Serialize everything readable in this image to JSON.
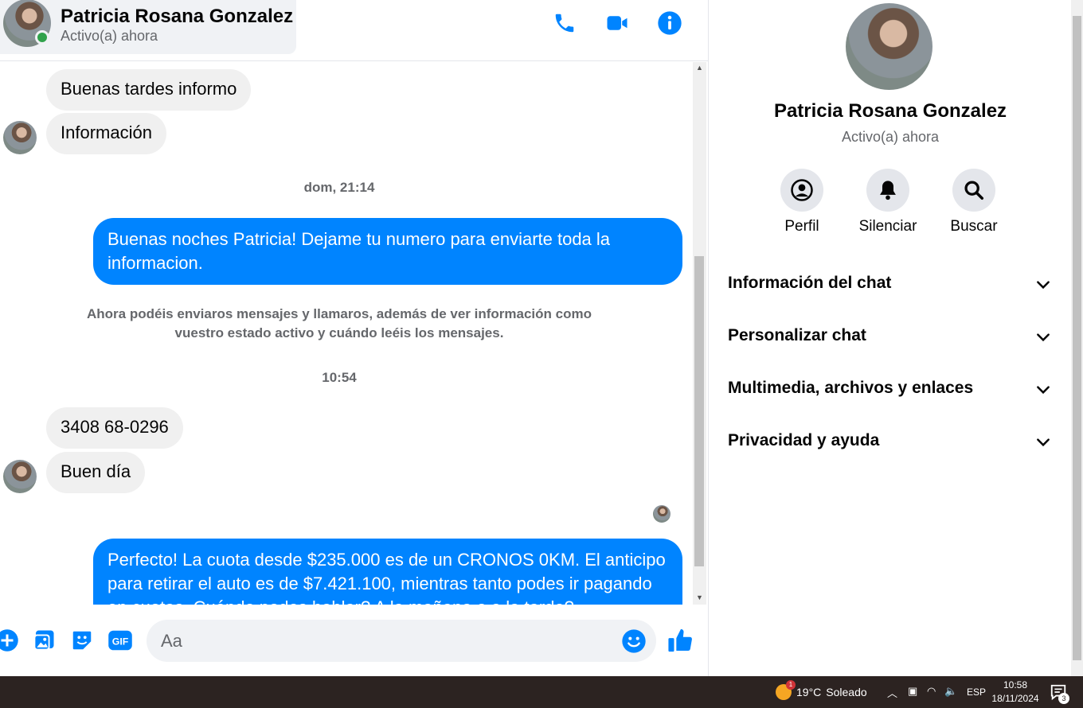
{
  "header": {
    "name": "Patricia Rosana Gonzalez",
    "status": "Activo(a) ahora"
  },
  "messages": {
    "in1": "Buenas tardes informo",
    "in2": "Información",
    "timestamp1": "dom, 21:14",
    "out1": "Buenas noches Patricia! Dejame tu numero para enviarte toda la informacion.",
    "system_note": "Ahora podéis enviaros mensajes y llamaros, además de ver información como vuestro estado activo y cuándo leéis los mensajes.",
    "timestamp2": "10:54",
    "in3": "3408 68-0296",
    "in4": "Buen día",
    "out2": "Perfecto! La cuota desde $235.000 es de un CRONOS 0KM. El anticipo para retirar el auto es de $7.421.100, mientras tanto podes ir pagando en cuotas. Cuándo podes hablar? A la mañana o a la tarde?"
  },
  "composer": {
    "placeholder": "Aa"
  },
  "right_panel": {
    "name": "Patricia Rosana Gonzalez",
    "status": "Activo(a) ahora",
    "actions": [
      "Perfil",
      "Silenciar",
      "Buscar"
    ],
    "sections": [
      "Información del chat",
      "Personalizar chat",
      "Multimedia, archivos y enlaces",
      "Privacidad y ayuda"
    ]
  },
  "taskbar": {
    "temperature": "19°C",
    "weather": "Soleado",
    "weather_badge": "1",
    "language": "ESP",
    "time": "10:58",
    "date": "18/11/2024",
    "notification_count": "3"
  },
  "colors": {
    "accent": "#0084ff",
    "bubble_incoming": "#f0f0f0",
    "online": "#31a24c"
  }
}
